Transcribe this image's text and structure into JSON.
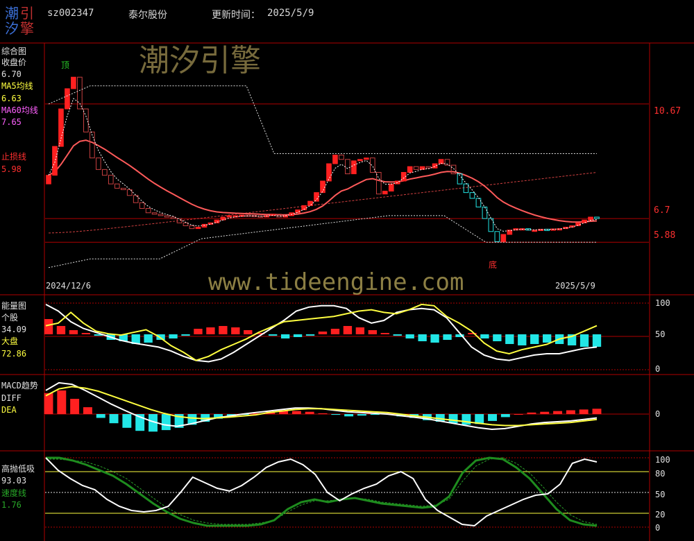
{
  "header": {
    "logo_chars": [
      "潮",
      "引",
      "汐",
      "擎"
    ],
    "code": "sz002347",
    "name": "泰尔股份",
    "update_label": "更新时间：",
    "update_date": "2025/5/9"
  },
  "watermark": {
    "brand": "潮汐引擎",
    "url": "www.tideengine.com"
  },
  "colors": {
    "up": "#ff2020",
    "down": "#22e6e6",
    "ma5": "#ffffff",
    "ma60": "#ff5a5a",
    "grid": "#b00000",
    "yellow": "#ffff40",
    "green": "#1e8c1e"
  },
  "chart_data": [
    {
      "type": "candlestick",
      "panel": "综合图",
      "legend": {
        "close_label": "收盘价",
        "close_value": "6.70",
        "ma5_label": "MA5均线",
        "ma5_value": "6.63",
        "ma60_label": "MA60均线",
        "ma60_value": "7.65",
        "stop_label": "止损线",
        "stop_value": "5.98"
      },
      "date_start": "2024/12/6",
      "date_end": "2025/5/9",
      "top_marker": "顶",
      "bottom_marker": "底",
      "right_ticks": [
        "10.67",
        "6.7",
        "5.88"
      ],
      "closes": [
        8.2,
        9.2,
        10.5,
        11.2,
        11.6,
        10.5,
        9.7,
        8.8,
        8.4,
        8.2,
        7.9,
        7.75,
        7.7,
        7.5,
        7.25,
        7.05,
        6.9,
        6.85,
        6.8,
        6.75,
        6.7,
        6.55,
        6.45,
        6.35,
        6.4,
        6.5,
        6.55,
        6.65,
        6.75,
        6.8,
        6.8,
        6.82,
        6.81,
        6.79,
        6.76,
        6.8,
        6.85,
        6.75,
        6.8,
        6.9,
        7.0,
        7.15,
        7.3,
        7.6,
        8.0,
        8.6,
        8.9,
        8.75,
        8.25,
        8.7,
        8.75,
        8.8,
        8.3,
        7.55,
        7.65,
        7.9,
        8.0,
        8.3,
        8.5,
        8.4,
        8.5,
        8.45,
        8.6,
        8.75,
        8.55,
        8.25,
        7.9,
        7.6,
        7.4,
        7.1,
        6.7,
        6.25,
        5.9,
        6.15,
        6.3,
        6.35,
        6.35,
        6.3,
        6.3,
        6.33,
        6.32,
        6.34,
        6.35,
        6.4,
        6.45,
        6.55,
        6.65,
        6.75,
        6.7
      ],
      "stop_line_levels": [
        11.3,
        8.9,
        6.35,
        5.3
      ],
      "stop_line_upper_span": [
        10.67,
        11.3,
        8.95,
        6.7
      ],
      "stop_line_lower_span": [
        5.0,
        5.3,
        6.0,
        6.8,
        5.88
      ]
    },
    {
      "type": "line+histogram",
      "panel": "能量图",
      "legend": {
        "stock_label": "个股",
        "stock_value": "34.09",
        "market_label": "大盘",
        "market_value": "72.86"
      },
      "right_ticks": [
        "100",
        "50",
        "0"
      ],
      "stock_white": [
        98,
        88,
        72,
        62,
        56,
        50,
        44,
        40,
        37,
        34,
        28,
        20,
        14,
        12,
        16,
        26,
        38,
        50,
        62,
        74,
        88,
        94,
        96,
        96,
        92,
        78,
        70,
        74,
        86,
        90,
        92,
        90,
        78,
        56,
        34,
        22,
        16,
        14,
        18,
        22,
        24,
        24,
        28,
        32,
        34
      ],
      "market_yellow": [
        66,
        70,
        86,
        70,
        58,
        54,
        52,
        56,
        60,
        50,
        36,
        26,
        14,
        20,
        30,
        38,
        46,
        56,
        64,
        72,
        74,
        76,
        78,
        80,
        84,
        88,
        90,
        86,
        84,
        90,
        98,
        96,
        80,
        70,
        58,
        40,
        28,
        24,
        30,
        34,
        38,
        46,
        50,
        58,
        66
      ],
      "histogram": [
        22,
        12,
        6,
        2,
        -2,
        -8,
        -10,
        -14,
        -12,
        -8,
        -6,
        -2,
        8,
        10,
        12,
        10,
        6,
        2,
        -2,
        -6,
        -4,
        -2,
        4,
        8,
        12,
        10,
        6,
        2,
        -2,
        -6,
        -10,
        -12,
        -8,
        -4,
        2,
        -6,
        -10,
        -14,
        -16,
        -14,
        -12,
        -14,
        -16,
        -18,
        -18
      ]
    },
    {
      "type": "line+histogram",
      "panel": "MACD趋势",
      "legend": {
        "diff_label": "DIFF",
        "dea_label": "DEA"
      },
      "right_ticks": [
        "0"
      ],
      "diff_white": [
        0.62,
        0.82,
        0.78,
        0.62,
        0.44,
        0.26,
        0.1,
        -0.05,
        -0.18,
        -0.28,
        -0.32,
        -0.26,
        -0.18,
        -0.1,
        -0.05,
        0.0,
        0.04,
        0.08,
        0.12,
        0.16,
        0.16,
        0.14,
        0.1,
        0.06,
        0.04,
        0.02,
        0.0,
        -0.04,
        -0.08,
        -0.12,
        -0.18,
        -0.24,
        -0.3,
        -0.36,
        -0.4,
        -0.38,
        -0.32,
        -0.26,
        -0.22,
        -0.2,
        -0.18,
        -0.14,
        -0.1
      ],
      "dea_yellow": [
        0.48,
        0.66,
        0.72,
        0.68,
        0.6,
        0.48,
        0.36,
        0.24,
        0.12,
        0.02,
        -0.06,
        -0.1,
        -0.12,
        -0.1,
        -0.08,
        -0.05,
        -0.02,
        0.04,
        0.08,
        0.12,
        0.14,
        0.14,
        0.12,
        0.1,
        0.08,
        0.06,
        0.04,
        0.0,
        -0.04,
        -0.08,
        -0.12,
        -0.16,
        -0.2,
        -0.24,
        -0.28,
        -0.3,
        -0.3,
        -0.28,
        -0.26,
        -0.24,
        -0.22,
        -0.18,
        -0.14
      ],
      "histogram": [
        0.55,
        0.62,
        0.4,
        0.18,
        -0.1,
        -0.24,
        -0.36,
        -0.44,
        -0.46,
        -0.42,
        -0.36,
        -0.28,
        -0.2,
        -0.12,
        -0.06,
        -0.02,
        0.02,
        0.06,
        0.1,
        0.08,
        0.06,
        0.02,
        -0.02,
        -0.06,
        -0.04,
        -0.02,
        0.02,
        -0.06,
        -0.1,
        -0.16,
        -0.2,
        -0.24,
        -0.28,
        -0.26,
        -0.18,
        -0.08,
        0.0,
        0.04,
        0.06,
        0.08,
        0.1,
        0.12,
        0.14
      ]
    },
    {
      "type": "line",
      "panel": "高抛低吸",
      "legend": {
        "value": "93.03",
        "speed_label": "速度线",
        "speed_value": "1.76"
      },
      "right_ticks": [
        "100",
        "80",
        "50",
        "20",
        "0"
      ],
      "white_line": [
        100,
        82,
        70,
        60,
        54,
        40,
        30,
        24,
        22,
        24,
        30,
        50,
        72,
        64,
        56,
        52,
        60,
        72,
        86,
        94,
        98,
        90,
        76,
        50,
        38,
        48,
        56,
        62,
        74,
        80,
        70,
        40,
        24,
        14,
        4,
        2,
        16,
        24,
        32,
        40,
        46,
        48,
        62,
        92,
        98,
        94
      ],
      "green_line": [
        100,
        100,
        96,
        90,
        82,
        74,
        62,
        48,
        34,
        22,
        12,
        6,
        2,
        2,
        2,
        2,
        4,
        10,
        26,
        36,
        40,
        36,
        40,
        42,
        38,
        34,
        32,
        30,
        28,
        30,
        44,
        78,
        96,
        100,
        98,
        86,
        70,
        48,
        26,
        10,
        4,
        2
      ],
      "green_dashed": [
        98,
        98,
        96,
        94,
        88,
        80,
        70,
        56,
        42,
        28,
        18,
        10,
        6,
        4,
        4,
        4,
        6,
        10,
        22,
        32,
        38,
        38,
        40,
        42,
        40,
        36,
        34,
        32,
        30,
        32,
        40,
        66,
        88,
        98,
        100,
        92,
        78,
        58,
        36,
        18,
        8,
        4
      ]
    }
  ]
}
